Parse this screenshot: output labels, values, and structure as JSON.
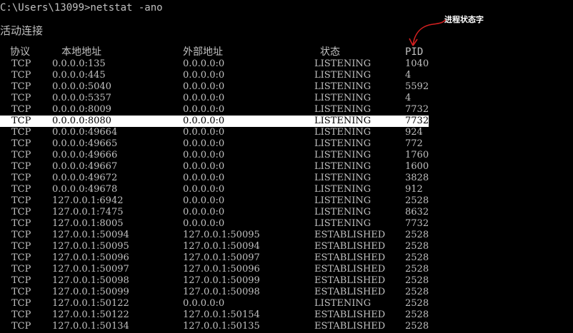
{
  "console": {
    "prompt": "C:\\Users\\13099>netstat -ano",
    "section_title": "活动连接"
  },
  "columns": {
    "protocol": "协议",
    "local_address": "本地地址",
    "foreign_address": "外部地址",
    "state": "状态",
    "pid": "PID"
  },
  "rows": [
    {
      "protocol": "TCP",
      "local": "0.0.0.0:135",
      "foreign": "0.0.0.0:0",
      "state": "LISTENING",
      "pid": "1040"
    },
    {
      "protocol": "TCP",
      "local": "0.0.0.0:445",
      "foreign": "0.0.0.0:0",
      "state": "LISTENING",
      "pid": "4"
    },
    {
      "protocol": "TCP",
      "local": "0.0.0.0:5040",
      "foreign": "0.0.0.0:0",
      "state": "LISTENING",
      "pid": "5592"
    },
    {
      "protocol": "TCP",
      "local": "0.0.0.0:5357",
      "foreign": "0.0.0.0:0",
      "state": "LISTENING",
      "pid": "4"
    },
    {
      "protocol": "TCP",
      "local": "0.0.0.0:8009",
      "foreign": "0.0.0.0:0",
      "state": "LISTENING",
      "pid": "7732"
    },
    {
      "protocol": "TCP",
      "local": "0.0.0.0:8080",
      "foreign": "0.0.0.0:0",
      "state": "LISTENING",
      "pid": "7732"
    },
    {
      "protocol": "TCP",
      "local": "0.0.0.0:49664",
      "foreign": "0.0.0.0:0",
      "state": "LISTENING",
      "pid": "924"
    },
    {
      "protocol": "TCP",
      "local": "0.0.0.0:49665",
      "foreign": "0.0.0.0:0",
      "state": "LISTENING",
      "pid": "772"
    },
    {
      "protocol": "TCP",
      "local": "0.0.0.0:49666",
      "foreign": "0.0.0.0:0",
      "state": "LISTENING",
      "pid": "1760"
    },
    {
      "protocol": "TCP",
      "local": "0.0.0.0:49667",
      "foreign": "0.0.0.0:0",
      "state": "LISTENING",
      "pid": "1600"
    },
    {
      "protocol": "TCP",
      "local": "0.0.0.0:49672",
      "foreign": "0.0.0.0:0",
      "state": "LISTENING",
      "pid": "3828"
    },
    {
      "protocol": "TCP",
      "local": "0.0.0.0:49678",
      "foreign": "0.0.0.0:0",
      "state": "LISTENING",
      "pid": "912"
    },
    {
      "protocol": "TCP",
      "local": "127.0.0.1:6942",
      "foreign": "0.0.0.0:0",
      "state": "LISTENING",
      "pid": "2528"
    },
    {
      "protocol": "TCP",
      "local": "127.0.0.1:7475",
      "foreign": "0.0.0.0:0",
      "state": "LISTENING",
      "pid": "8632"
    },
    {
      "protocol": "TCP",
      "local": "127.0.0.1:8005",
      "foreign": "0.0.0.0:0",
      "state": "LISTENING",
      "pid": "7732"
    },
    {
      "protocol": "TCP",
      "local": "127.0.0.1:50094",
      "foreign": "127.0.0.1:50095",
      "state": "ESTABLISHED",
      "pid": "2528"
    },
    {
      "protocol": "TCP",
      "local": "127.0.0.1:50095",
      "foreign": "127.0.0.1:50094",
      "state": "ESTABLISHED",
      "pid": "2528"
    },
    {
      "protocol": "TCP",
      "local": "127.0.0.1:50096",
      "foreign": "127.0.0.1:50097",
      "state": "ESTABLISHED",
      "pid": "2528"
    },
    {
      "protocol": "TCP",
      "local": "127.0.0.1:50097",
      "foreign": "127.0.0.1:50096",
      "state": "ESTABLISHED",
      "pid": "2528"
    },
    {
      "protocol": "TCP",
      "local": "127.0.0.1:50098",
      "foreign": "127.0.0.1:50099",
      "state": "ESTABLISHED",
      "pid": "2528"
    },
    {
      "protocol": "TCP",
      "local": "127.0.0.1:50099",
      "foreign": "127.0.0.1:50098",
      "state": "ESTABLISHED",
      "pid": "2528"
    },
    {
      "protocol": "TCP",
      "local": "127.0.0.1:50122",
      "foreign": "0.0.0.0:0",
      "state": "LISTENING",
      "pid": "2528"
    },
    {
      "protocol": "TCP",
      "local": "127.0.0.1:50122",
      "foreign": "127.0.0.1:50154",
      "state": "ESTABLISHED",
      "pid": "2528"
    },
    {
      "protocol": "TCP",
      "local": "127.0.0.1:50134",
      "foreign": "127.0.0.1:50135",
      "state": "ESTABLISHED",
      "pid": "2528"
    }
  ],
  "selected_row_index": 5,
  "annotation": {
    "text": "进程状态字",
    "color": "#ffffff",
    "arrow_color": "#d42020"
  },
  "colors": {
    "background": "#000000",
    "foreground": "#c0c0c0",
    "selection_background": "#ffffff",
    "selection_foreground": "#000000"
  }
}
